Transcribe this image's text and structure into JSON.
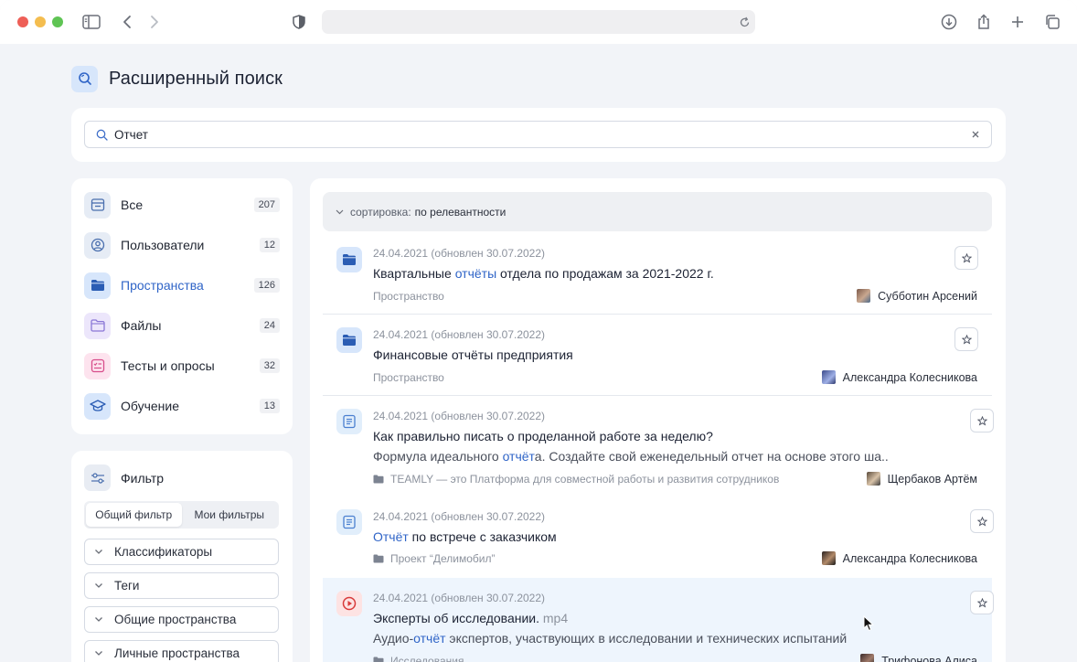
{
  "page": {
    "title": "Расширенный поиск"
  },
  "search": {
    "value": "Отчет"
  },
  "categories": [
    {
      "label": "Все",
      "count": "207",
      "icon": "inbox-icon",
      "color": "#e6ecf5",
      "active": false
    },
    {
      "label": "Пользователи",
      "count": "12",
      "icon": "user-circle-icon",
      "color": "#e6ecf5",
      "active": false
    },
    {
      "label": "Пространства",
      "count": "126",
      "icon": "folder-icon",
      "color": "#d7e6fb",
      "active": true
    },
    {
      "label": "Файлы",
      "count": "24",
      "icon": "file-folder-icon",
      "color": "#ece6fb",
      "active": false
    },
    {
      "label": "Тесты и опросы",
      "count": "32",
      "icon": "quiz-icon",
      "color": "#fde3ee",
      "active": false
    },
    {
      "label": "Обучение",
      "count": "13",
      "icon": "graduation-cap-icon",
      "color": "#d7e6fb",
      "active": false
    }
  ],
  "filter": {
    "title": "Фильтр",
    "tabs": [
      "Общий фильтр",
      "Мои фильтры"
    ],
    "active_tab": "Общий фильтр",
    "sections": [
      "Классификаторы",
      "Теги",
      "Общие пространства",
      "Личные пространства"
    ]
  },
  "sort": {
    "label": "сортировка:",
    "value": "по релевантности"
  },
  "results": [
    {
      "date": "24.04.2021 (обновлен 30.07.2022)",
      "title_before": "Квартальные ",
      "title_hit": "отчёты",
      "title_after": " отдела по продажам за 2021-2022 г.",
      "type": "Пространство",
      "author": "Субботин Арсений",
      "icon": "folder-icon"
    },
    {
      "date": "24.04.2021 (обновлен 30.07.2022)",
      "title_before": "Финансовые отчёты предприятия",
      "type": "Пространство",
      "author": "Александра Колесникова",
      "icon": "folder-icon"
    },
    {
      "date": "24.04.2021 (обновлен 30.07.2022)",
      "title_before": "Как правильно писать о проделанной работе за неделю?",
      "desc_before": "Формула идеального ",
      "desc_hit": "отчёт",
      "desc_after": "а. Создайте свой еженедельный отчет на основе этого ша..",
      "path": "TEAMLY — это Платформа для совместной работы и развития сотрудников",
      "author": "Щербаков Артём",
      "icon": "document-icon"
    },
    {
      "date": "24.04.2021 (обновлен 30.07.2022)",
      "title_hit": "Отчёт",
      "title_after": " по встрече с заказчиком",
      "path": "Проект “Делимобил”",
      "author": "Александра Колесникова",
      "icon": "document-icon"
    },
    {
      "date": "24.04.2021 (обновлен 30.07.2022)",
      "title_before": "Эксперты об исследовании.",
      "title_ext": " mp4",
      "desc_before": "Аудио-",
      "desc_hit": "отчёт",
      "desc_after": " экспертов, участвующих в исследовании и технических испытаний",
      "path": "Исследования",
      "author": "Трифонова Алиса",
      "icon": "play-video-icon"
    }
  ]
}
